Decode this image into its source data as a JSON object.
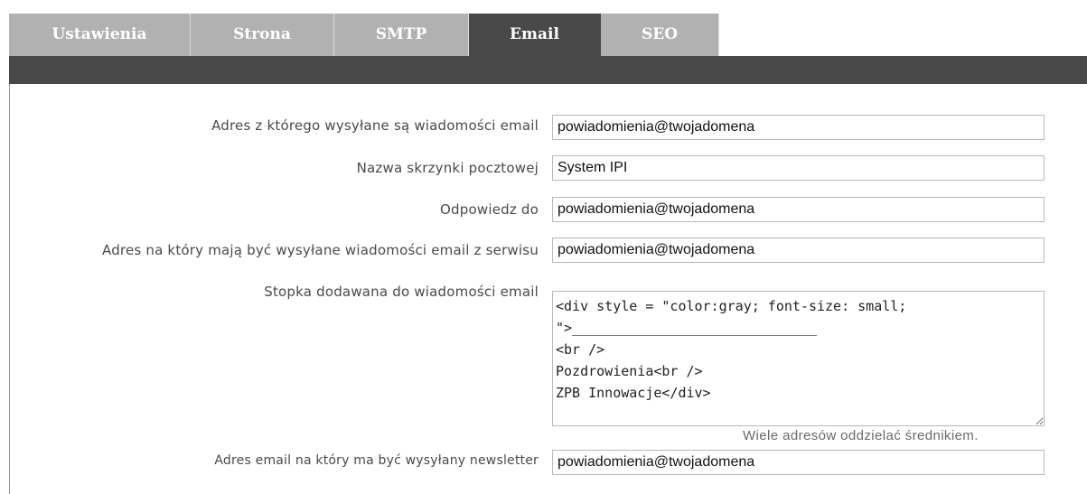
{
  "tabs": [
    {
      "label": "Ustawienia",
      "active": false
    },
    {
      "label": "Strona",
      "active": false
    },
    {
      "label": "SMTP",
      "active": false
    },
    {
      "label": "Email",
      "active": true
    },
    {
      "label": "SEO",
      "active": false
    }
  ],
  "colors": {
    "tab_inactive": "#b1b1b1",
    "tab_active": "#484848",
    "header_bar": "#484848"
  },
  "form": {
    "sender_address": {
      "label": "Adres z którego wysyłane są wiadomości email",
      "value": "powiadomienia@twojadomena"
    },
    "mailbox_name": {
      "label": "Nazwa skrzynki pocztowej",
      "value": "System IPI"
    },
    "reply_to": {
      "label": "Odpowiedz do",
      "value": "powiadomienia@twojadomena"
    },
    "service_recipient": {
      "label": "Adres na który mają być wysyłane wiadomości email z serwisu",
      "value": "powiadomienia@twojadomena"
    },
    "footer": {
      "label": "Stopka dodawana do wiadomości email",
      "value": "<div style = \"color:gray; font-size: small; \">______________________________\n<br />\nPozdrowienia<br />\nZPB Innowacje</div>",
      "hint": "Wiele adresów oddzielać średnikiem."
    },
    "newsletter_address": {
      "label": "Adres email na który ma być wysyłany newsletter",
      "value": "powiadomienia@twojadomena"
    }
  }
}
